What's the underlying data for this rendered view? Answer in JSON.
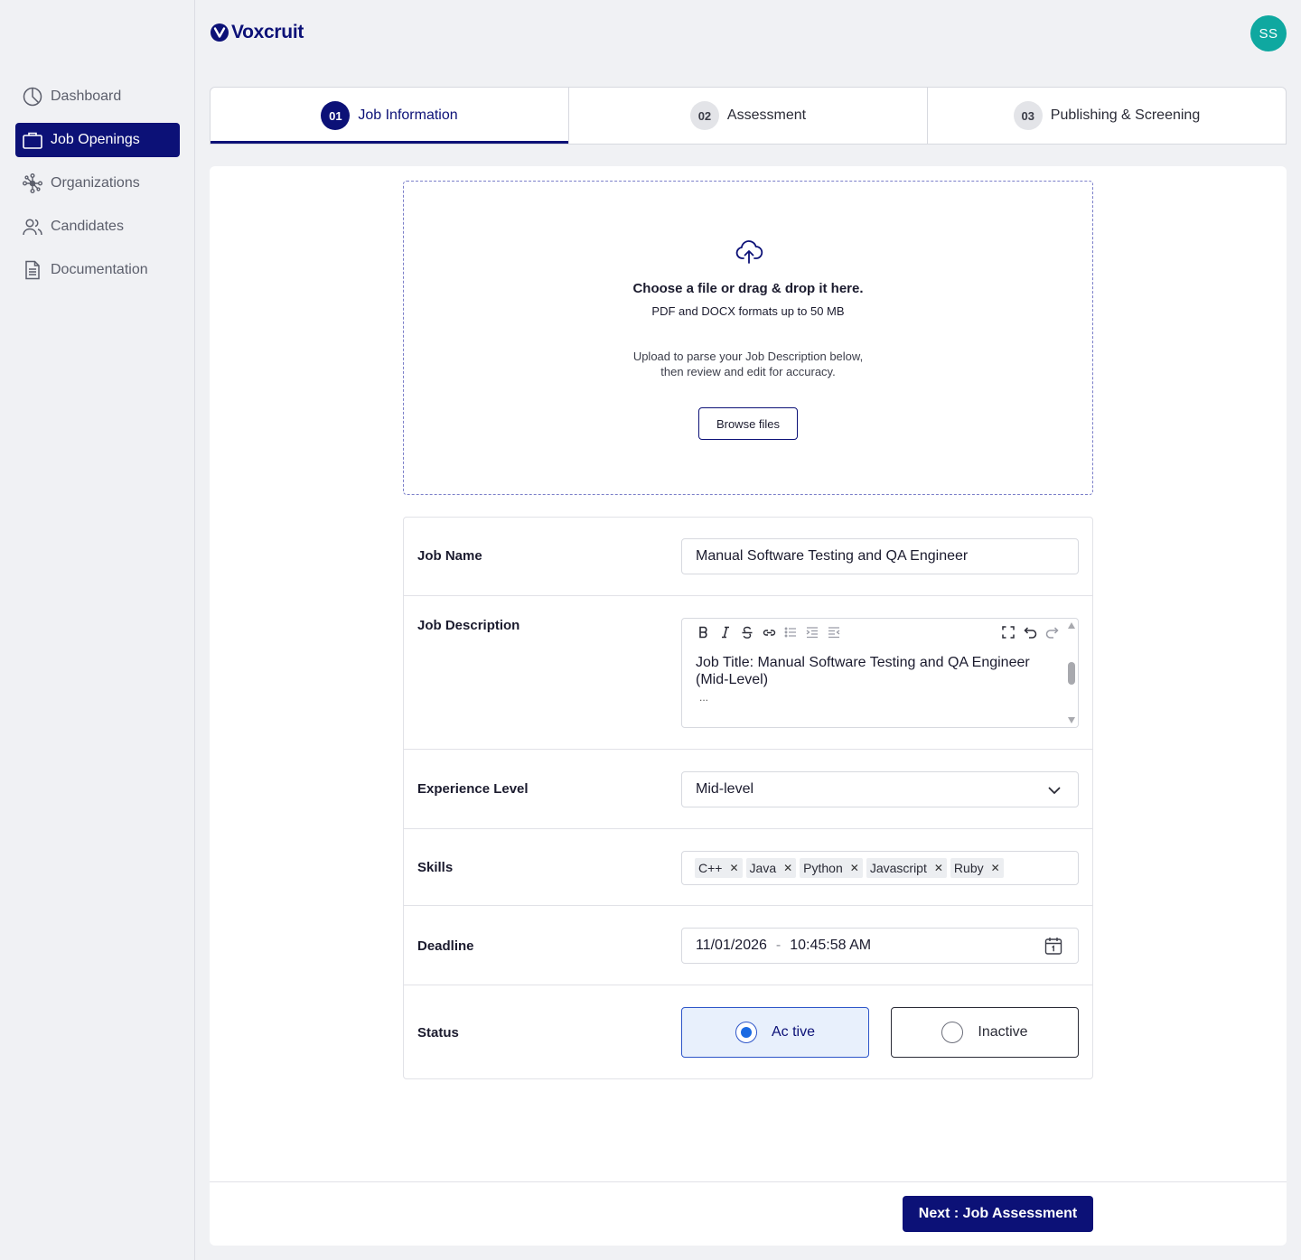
{
  "brand": {
    "name": "Voxcruit"
  },
  "user": {
    "initials": "SS"
  },
  "sidebar": {
    "items": [
      {
        "label": "Dashboard",
        "icon": "pie-chart-icon"
      },
      {
        "label": "Job Openings",
        "icon": "briefcase-icon",
        "active": true
      },
      {
        "label": "Organizations",
        "icon": "network-icon"
      },
      {
        "label": "Candidates",
        "icon": "users-icon"
      },
      {
        "label": "Documentation",
        "icon": "document-icon"
      }
    ]
  },
  "steps": [
    {
      "num": "01",
      "label": "Job Information",
      "active": true
    },
    {
      "num": "02",
      "label": "Assessment"
    },
    {
      "num": "03",
      "label": "Publishing & Screening"
    }
  ],
  "upload": {
    "title": "Choose a file or drag & drop it here.",
    "formats": "PDF and DOCX formats up to 50 MB",
    "note_line1": "Upload to parse your Job Description below,",
    "note_line2": "then review and edit for accuracy.",
    "browse_label": "Browse files"
  },
  "form": {
    "job_name": {
      "label": "Job Name",
      "value": "Manual Software Testing and QA Engineer"
    },
    "job_description": {
      "label": "Job Description",
      "value": "Job Title: Manual Software Testing and QA Engineer (Mid-Level)",
      "more": "..."
    },
    "experience_level": {
      "label": "Experience Level",
      "value": "Mid-level"
    },
    "skills": {
      "label": "Skills",
      "items": [
        "C++",
        "Java",
        "Python",
        "Javascript",
        "Ruby"
      ]
    },
    "deadline": {
      "label": "Deadline",
      "date": "11/01/2026",
      "separator": "-",
      "time": "10:45:58 AM"
    },
    "status": {
      "label": "Status",
      "options": [
        "Ac tive",
        "Inactive"
      ],
      "selected": "Ac tive"
    }
  },
  "footer": {
    "next_label": "Next : Job Assessment"
  },
  "colors": {
    "primary": "#0c1177",
    "avatar": "#0fa8a0",
    "radio_selected": "#1b6ae2"
  }
}
